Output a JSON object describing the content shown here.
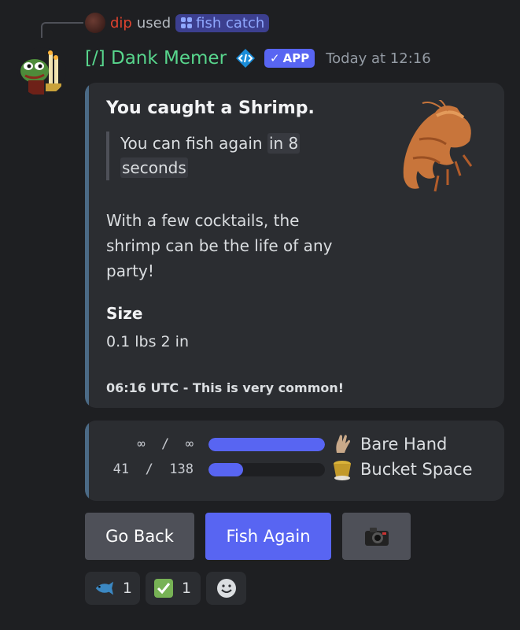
{
  "reply": {
    "username": "dip",
    "used_text": "used",
    "command_label": "fish catch"
  },
  "header": {
    "bot_name": "[/] Dank Memer",
    "app_badge": "APP",
    "timestamp": "Today at 12:16"
  },
  "embed": {
    "title": "You caught a Shrimp.",
    "quote_prefix": "You can fish again ",
    "quote_code_1": "in 8",
    "quote_code_2": "seconds",
    "description": "With a few cocktails, the shrimp can be the life of any party!",
    "field_name": "Size",
    "field_value": "0.1 lbs 2 in",
    "footer": "06:16 UTC - This is very common!"
  },
  "stats": [
    {
      "numbers": "∞  /  ∞",
      "fill_fraction": 1.0,
      "icon": "hand-icon",
      "label": "Bare Hand"
    },
    {
      "numbers": "41  /  138",
      "fill_fraction": 0.297,
      "icon": "bucket-icon",
      "label": "Bucket Space"
    }
  ],
  "buttons": {
    "back": "Go Back",
    "fish_again": "Fish Again",
    "camera": "camera-icon"
  },
  "reactions": [
    {
      "icon": "fish-emoji",
      "count": "1"
    },
    {
      "icon": "check-mark-emoji",
      "count": "1"
    },
    {
      "icon": "add-reaction-icon",
      "count": ""
    }
  ],
  "colors": {
    "background": "#1e1f22",
    "embed": "#2b2d31",
    "embed_accent": "#4b6a86",
    "bot_name": "#58d68d",
    "blurple": "#5865f2",
    "username": "#e0432f",
    "grey_button": "#4e5058"
  }
}
